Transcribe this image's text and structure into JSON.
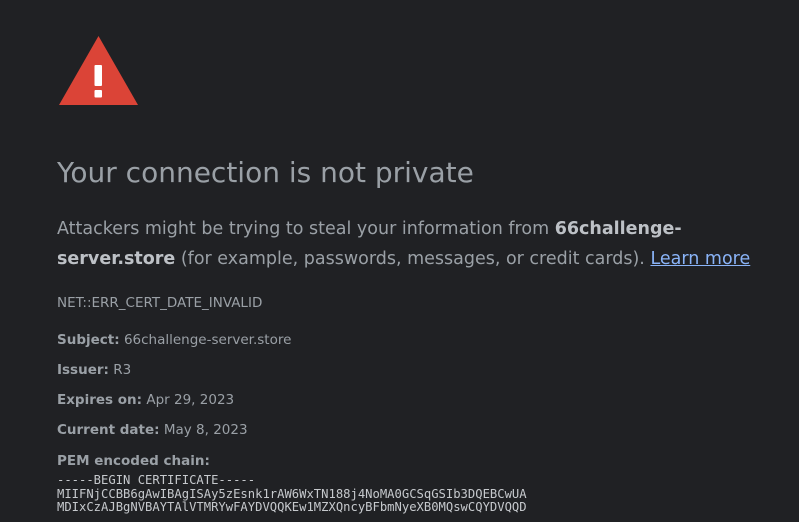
{
  "warning": {
    "icon": "warning-triangle-icon",
    "icon_color": "#db4437"
  },
  "heading": "Your connection is not private",
  "message": {
    "before_domain": "Attackers might be trying to steal your information from ",
    "domain": "66challenge-server.store",
    "after_domain": " (for example, passwords, messages, or credit cards).",
    "learn_more": "Learn more"
  },
  "error_code": "NET::ERR_CERT_DATE_INVALID",
  "details": {
    "subject_label": "Subject:",
    "subject_value": "66challenge-server.store",
    "issuer_label": "Issuer:",
    "issuer_value": "R3",
    "expires_label": "Expires on:",
    "expires_value": "Apr 29, 2023",
    "current_label": "Current date:",
    "current_value": "May 8, 2023",
    "pem_label": "PEM encoded chain:"
  },
  "pem_lines": [
    "-----BEGIN CERTIFICATE-----",
    "MIIFNjCCBB6gAwIBAgISAy5zEsnk1rAW6WxTN188j4NoMA0GCSqGSIb3DQEBCwUA",
    "MDIxCzAJBgNVBAYTAlVTMRYwFAYDVQQKEw1MZXQncyBFbmNyeXB0MQswCQYDVQQD"
  ]
}
